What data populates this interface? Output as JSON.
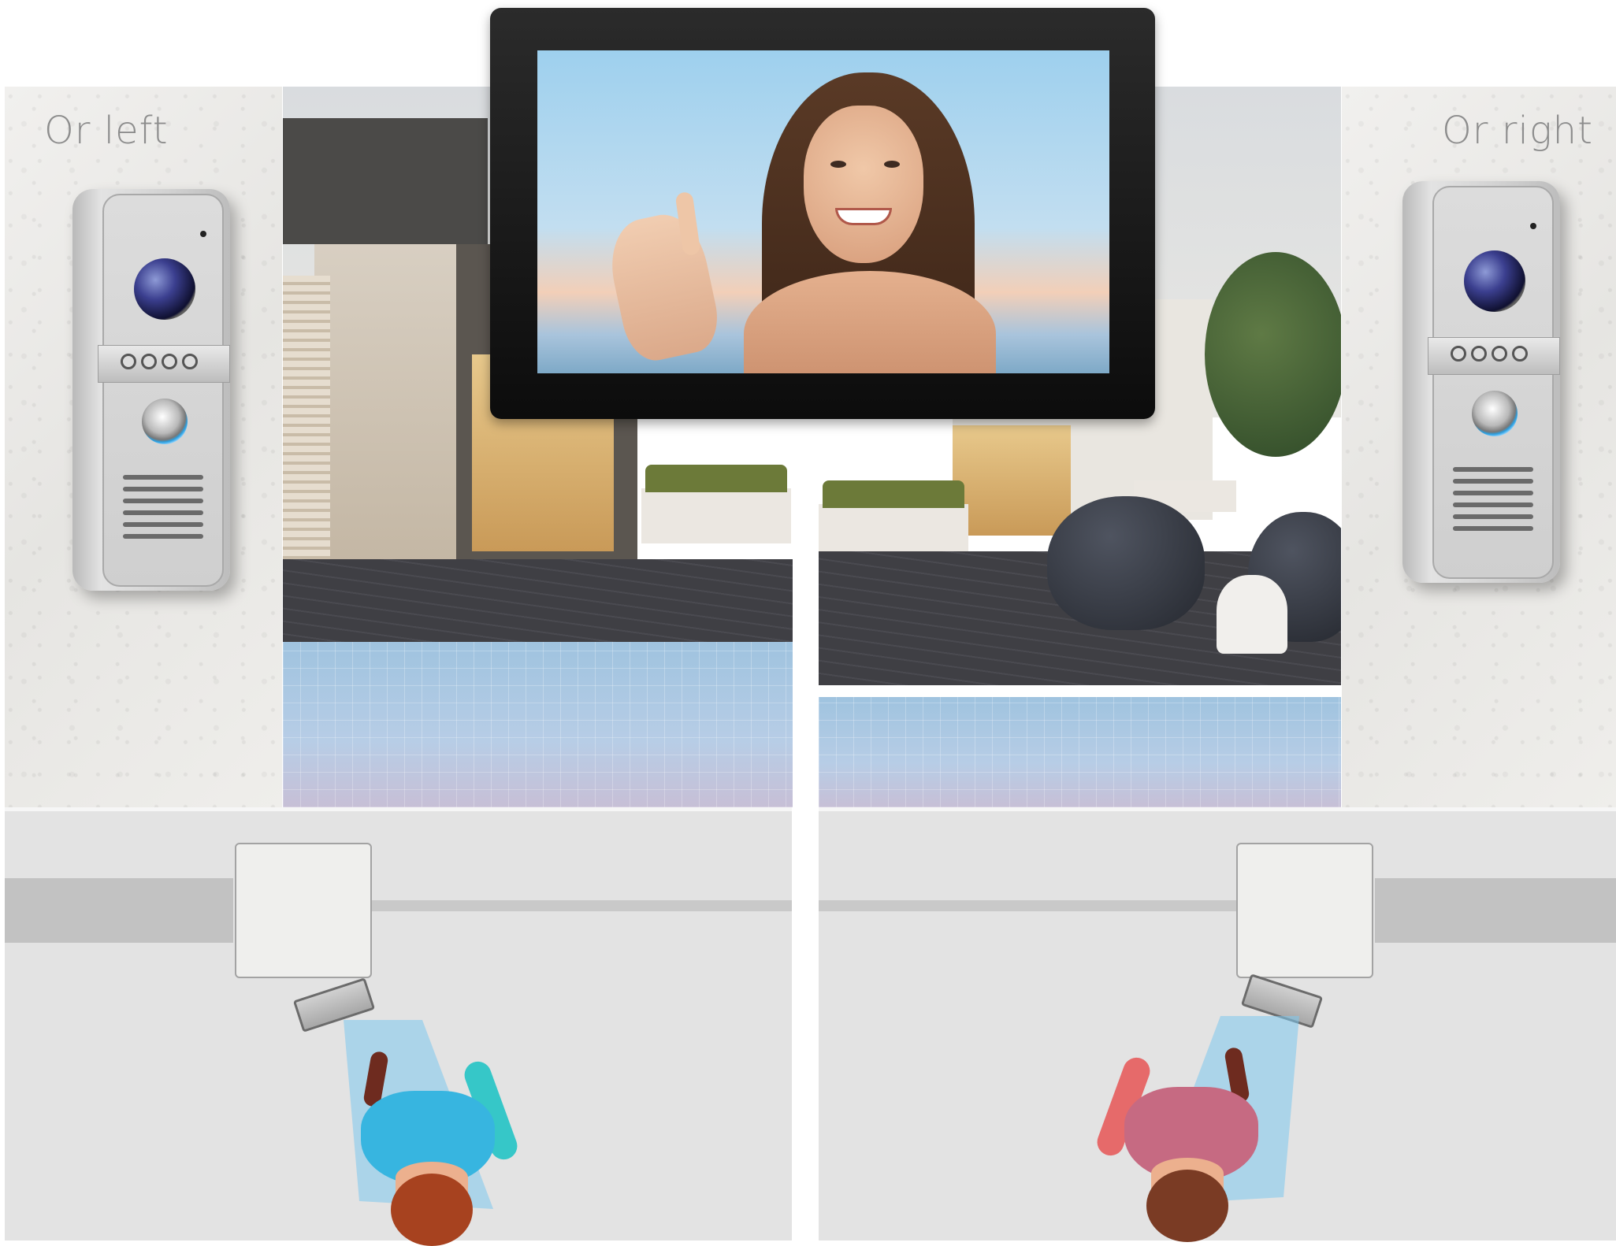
{
  "labels": {
    "left": "Or left",
    "right": "Or right"
  },
  "colors": {
    "panel_led": "#2a9fe0",
    "person_left": "#37b5e0",
    "person_right": "#e66a6a",
    "fov": "#7ec8ee",
    "hair": "#a7421f"
  },
  "icons": {
    "door_panel_left": "door-station-icon",
    "door_panel_right": "door-station-icon",
    "monitor": "video-monitor-icon",
    "camera_left": "camera-icon",
    "camera_right": "camera-icon",
    "person_left": "person-topview-icon",
    "person_right": "person-topview-icon"
  }
}
